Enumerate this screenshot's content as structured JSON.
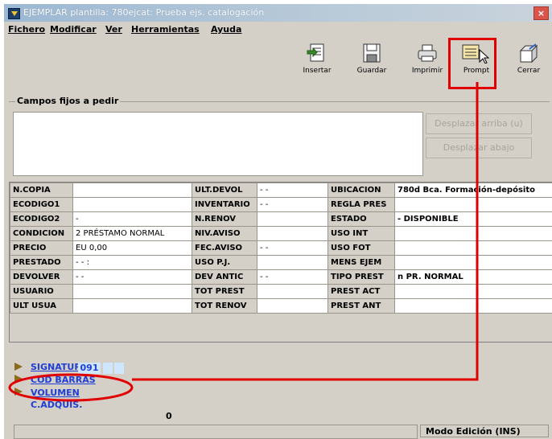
{
  "window": {
    "title": "EJEMPLAR plantilla: 780ejcat: Prueba ejs. catalogación",
    "close_label": "×"
  },
  "menu": [
    "Fichero",
    "Modificar",
    "Ver",
    "Herramientas",
    "Ayuda"
  ],
  "toolbar": {
    "insertar": "Insertar",
    "guardar": "Guardar",
    "imprimir": "Imprimir",
    "prompt": "Prompt",
    "cerrar": "Cerrar"
  },
  "campos": {
    "label": "Campos fijos a pedir",
    "up_button": "Desplazar arriba (u)",
    "down_button": "Desplazar abajo"
  },
  "grid": [
    [
      "N.COPIA",
      "",
      "ULT.DEVOL",
      "- -",
      "UBICACION",
      "780d   Bca. Formación-depósito"
    ],
    [
      "ECODIGO1",
      "",
      "INVENTARIO",
      "- -",
      "REGLA PRES",
      ""
    ],
    [
      "ECODIGO2",
      "-",
      "N.RENOV",
      "",
      "ESTADO",
      "-   DISPONIBLE"
    ],
    [
      "CONDICION",
      "2   PRÉSTAMO NORMAL",
      "NIV.AVISO",
      "",
      "USO INT",
      ""
    ],
    [
      "PRECIO",
      "EU 0,00",
      "FEC.AVISO",
      "- -",
      "USO FOT",
      ""
    ],
    [
      "PRESTADO",
      "- -     :",
      "USO P.J.",
      "",
      "MENS EJEM",
      ""
    ],
    [
      "DEVOLVER",
      "- -",
      "DEV ANTIC",
      "- -",
      "TIPO PREST",
      "n   PR. NORMAL"
    ],
    [
      "USUARIO",
      "",
      "TOT PREST",
      "",
      "PREST ACT",
      ""
    ],
    [
      "ULT USUA",
      "",
      "TOT RENOV",
      "",
      "PREST ANT",
      ""
    ]
  ],
  "fields": {
    "signatura_label": "SIGNATURA",
    "signatura_value": "091",
    "codbarras_label": "COD BARRAS",
    "volumen_label": "VOLUMEN",
    "cadquis_label": "C.ADQUIS.",
    "cadquis_value": "0"
  },
  "status": {
    "mode": "Modo Edición (INS)"
  },
  "colors": {
    "window_bg": "#d4d0c8",
    "field_link": "#1e3ed6",
    "annotation": "#e00000"
  }
}
